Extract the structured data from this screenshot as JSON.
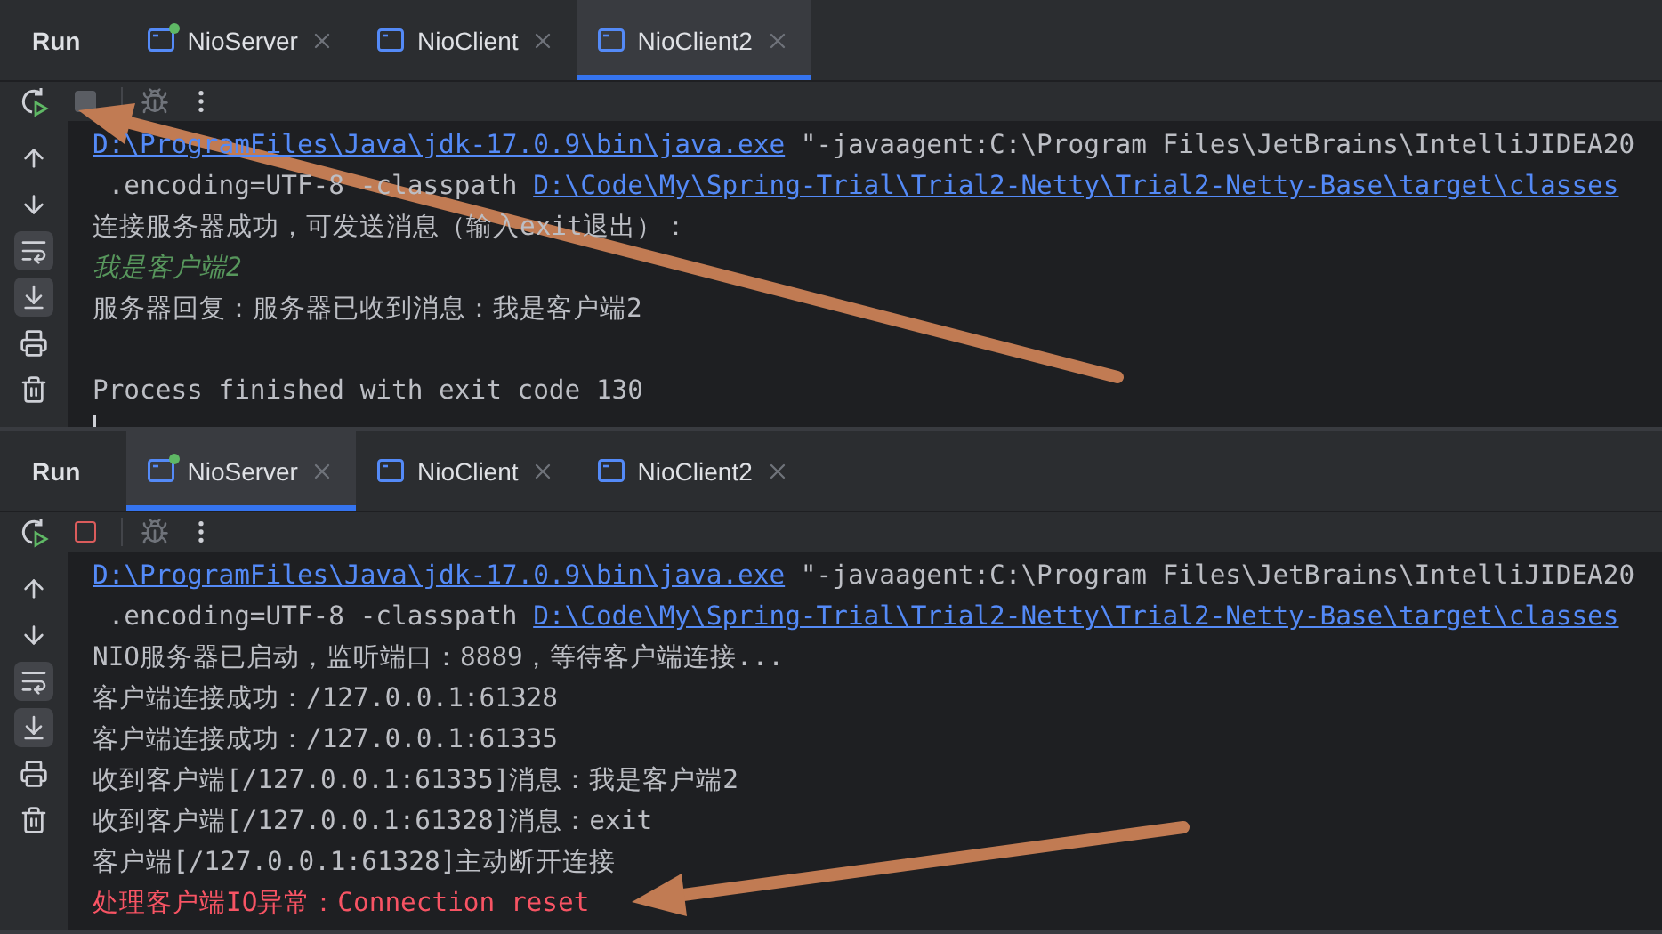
{
  "panels": [
    {
      "run_label": "Run",
      "stop_enabled": false,
      "soft_wrap": true,
      "scroll_to_end": true,
      "tabs": [
        {
          "label": "NioServer",
          "selected": false,
          "running": true
        },
        {
          "label": "NioClient",
          "selected": false,
          "running": false
        },
        {
          "label": "NioClient2",
          "selected": true,
          "running": false
        }
      ],
      "console": {
        "caret": true,
        "lines": [
          {
            "kind": "output",
            "segments": [
              {
                "kind": "link",
                "text": "D:\\ProgramFiles\\Java\\jdk-17.0.9\\bin\\java.exe"
              },
              {
                "kind": "text",
                "text": " \"-javaagent:C:\\Program Files\\JetBrains\\IntelliJIDEA20"
              }
            ]
          },
          {
            "kind": "output",
            "segments": [
              {
                "kind": "text",
                "text": " .encoding=UTF-8 -classpath "
              },
              {
                "kind": "link",
                "text": "D:\\Code\\My\\Spring-Trial\\Trial2-Netty\\Trial2-Netty-Base\\target\\classes"
              }
            ]
          },
          {
            "kind": "output",
            "text": "连接服务器成功，可发送消息（输入exit退出）："
          },
          {
            "kind": "input",
            "text": "我是客户端2"
          },
          {
            "kind": "output",
            "text": "服务器回复：服务器已收到消息：我是客户端2"
          },
          {
            "kind": "status",
            "text": "Process finished with exit code 130"
          }
        ]
      }
    },
    {
      "run_label": "Run",
      "stop_enabled": true,
      "soft_wrap": true,
      "scroll_to_end": true,
      "tabs": [
        {
          "label": "NioServer",
          "selected": true,
          "running": true
        },
        {
          "label": "NioClient",
          "selected": false,
          "running": false
        },
        {
          "label": "NioClient2",
          "selected": false,
          "running": false
        }
      ],
      "console": {
        "lines": [
          {
            "kind": "output",
            "segments": [
              {
                "kind": "link",
                "text": "D:\\ProgramFiles\\Java\\jdk-17.0.9\\bin\\java.exe"
              },
              {
                "kind": "text",
                "text": " \"-javaagent:C:\\Program Files\\JetBrains\\IntelliJIDEA20"
              }
            ]
          },
          {
            "kind": "output",
            "segments": [
              {
                "kind": "text",
                "text": " .encoding=UTF-8 -classpath "
              },
              {
                "kind": "link",
                "text": "D:\\Code\\My\\Spring-Trial\\Trial2-Netty\\Trial2-Netty-Base\\target\\classes"
              }
            ]
          },
          {
            "kind": "output",
            "text": "NIO服务器已启动，监听端口：8889，等待客户端连接..."
          },
          {
            "kind": "output",
            "text": "客户端连接成功：/127.0.0.1:61328"
          },
          {
            "kind": "output",
            "text": "客户端连接成功：/127.0.0.1:61335"
          },
          {
            "kind": "output",
            "text": "收到客户端[/127.0.0.1:61335]消息：我是客户端2"
          },
          {
            "kind": "output",
            "text": "收到客户端[/127.0.0.1:61328]消息：exit"
          },
          {
            "kind": "output",
            "text": "客户端[/127.0.0.1:61328]主动断开连接"
          },
          {
            "kind": "error",
            "text": "处理客户端IO异常：Connection reset"
          }
        ]
      }
    }
  ]
}
